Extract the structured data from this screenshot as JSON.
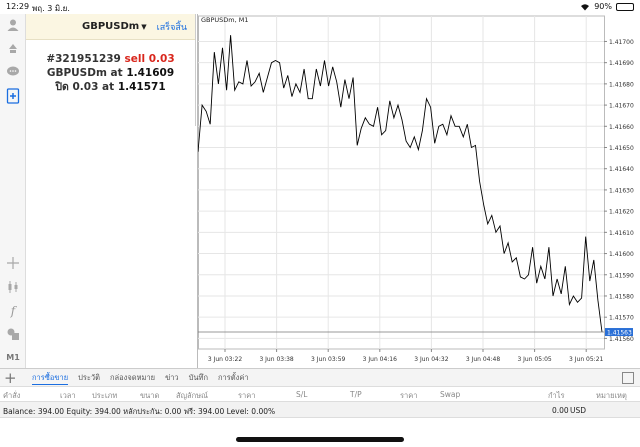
{
  "status_bar": {
    "time": "12:29",
    "date": "พฤ. 3 มิ.ย.",
    "battery": "90%"
  },
  "tool_column": {
    "icons": [
      "user-icon",
      "trade-icon",
      "chat-icon",
      "new-order-icon",
      "crosshair-icon",
      "candlestick-icon",
      "indicator-icon",
      "objects-icon"
    ],
    "timeframe": "M1"
  },
  "order_panel": {
    "symbol": "GBPUSDm",
    "done_label": "เสร็จสิ้น",
    "ticket": "#321951239",
    "action": "sell 0.03",
    "line2_prefix": "GBPUSDm at",
    "open_price": "1.41609",
    "line3_prefix": "ปิด 0.03 at",
    "close_price": "1.41571"
  },
  "chart": {
    "title": "GBPUSDm, M1",
    "current_price_label": "1.41563",
    "colors": {
      "line": "#000000",
      "grid": "#e6e6e6",
      "price_bg": "#2a6fd6"
    }
  },
  "chart_data": {
    "type": "line",
    "title": "GBPUSDm, M1",
    "xlabel": "",
    "ylabel": "",
    "ylim": [
      1.41555,
      1.41712
    ],
    "y_ticks": [
      "1.41700",
      "1.41690",
      "1.41680",
      "1.41670",
      "1.41660",
      "1.41650",
      "1.41640",
      "1.41630",
      "1.41620",
      "1.41610",
      "1.41600",
      "1.41590",
      "1.41580",
      "1.41570",
      "1.41560"
    ],
    "x_ticks": [
      "3 Jun 03:22",
      "3 Jun 03:38",
      "3 Jun 03:59",
      "3 Jun 04:16",
      "3 Jun 04:32",
      "3 Jun 04:48",
      "3 Jun 05:05",
      "3 Jun 05:21"
    ],
    "grid": true,
    "current_price": 1.41563,
    "series": [
      {
        "values": [
          1.41648,
          1.4167,
          1.41667,
          1.41661,
          1.41695,
          1.4168,
          1.41697,
          1.41677,
          1.41703,
          1.41677,
          1.41681,
          1.4168,
          1.41691,
          1.41679,
          1.41681,
          1.41685,
          1.41676,
          1.41683,
          1.4169,
          1.41691,
          1.4169,
          1.41678,
          1.41684,
          1.41674,
          1.4168,
          1.41676,
          1.41687,
          1.41673,
          1.41673,
          1.41687,
          1.41679,
          1.41691,
          1.41679,
          1.41688,
          1.41681,
          1.41669,
          1.41682,
          1.41673,
          1.41683,
          1.41651,
          1.41659,
          1.41664,
          1.41661,
          1.4166,
          1.41669,
          1.41656,
          1.41658,
          1.41672,
          1.41664,
          1.4167,
          1.41663,
          1.41653,
          1.4165,
          1.41655,
          1.41649,
          1.41658,
          1.41673,
          1.41669,
          1.41652,
          1.4166,
          1.41661,
          1.41656,
          1.41665,
          1.4166,
          1.4166,
          1.41655,
          1.41661,
          1.4165,
          1.41651,
          1.41634,
          1.41623,
          1.41614,
          1.41618,
          1.4161,
          1.41613,
          1.416,
          1.41605,
          1.41596,
          1.41598,
          1.41589,
          1.41588,
          1.4159,
          1.41603,
          1.41586,
          1.41594,
          1.41588,
          1.41603,
          1.4158,
          1.41588,
          1.41581,
          1.41594,
          1.41576,
          1.4158,
          1.41577,
          1.41579,
          1.41608,
          1.41587,
          1.41597,
          1.41578,
          1.41563
        ]
      }
    ]
  },
  "bottom_tabs": [
    "การซื้อขาย",
    "ประวัติ",
    "กล่องจดหมาย",
    "ข่าว",
    "บันทึก",
    "การตั้งค่า"
  ],
  "columns": [
    "คำสั่ง",
    "เวลา",
    "ประเภท",
    "ขนาด",
    "สัญลักษณ์",
    "ราคา",
    "S/L",
    "T/P",
    "ราคา",
    "Swap",
    "กำไร",
    "หมายเหตุ"
  ],
  "balance": {
    "text": "Balance: 394.00 Equity: 394.00 หลักประกัน: 0.00 ฟรี: 394.00 Level: 0.00%",
    "profit": "0.00",
    "currency": "USD"
  }
}
